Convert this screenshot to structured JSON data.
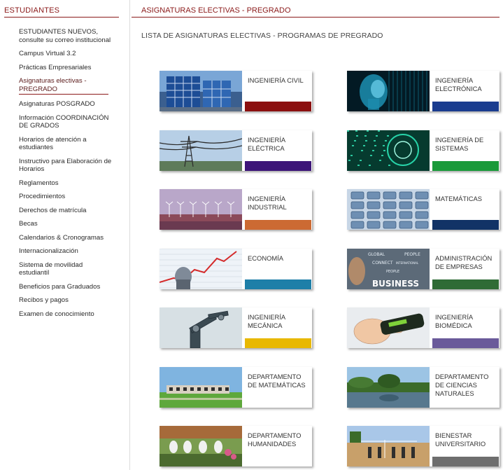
{
  "sidebar": {
    "title": "ESTUDIANTES",
    "items": [
      {
        "label": "ESTUDIANTES NUEVOS, consulte su correo institucional"
      },
      {
        "label": "Campus Virtual 3.2"
      },
      {
        "label": "Prácticas Empresariales"
      },
      {
        "label": "Asignaturas electivas - PREGRADO",
        "active": true
      },
      {
        "label": "Asignaturas POSGRADO"
      },
      {
        "label": "Información COORDINACIÓN DE GRADOS"
      },
      {
        "label": "Horarios de atención a estudiantes"
      },
      {
        "label": "Instructivo para Elaboración de Horarios"
      },
      {
        "label": "Reglamentos"
      },
      {
        "label": "Procedimientos"
      },
      {
        "label": "Derechos de matrícula"
      },
      {
        "label": "Becas"
      },
      {
        "label": "Calendarios & Cronogramas"
      },
      {
        "label": "Internacionalización"
      },
      {
        "label": "Sistema de movilidad estudiantil"
      },
      {
        "label": "Beneficios para Graduados"
      },
      {
        "label": "Recibos y pagos"
      },
      {
        "label": "Examen de conocimiento"
      }
    ]
  },
  "main": {
    "title": "ASIGNATURAS ELECTIVAS - PREGRADO",
    "subtitle": "LISTA DE ASIGNATURAS ELECTIVAS - PROGRAMAS DE PREGRADO",
    "image_text": {
      "business_main": "BUSINESS",
      "business_words": [
        "GLOBAL",
        "PEOPLE",
        "CONNECT",
        "INTERNATIONAL",
        "PEOPLE"
      ]
    },
    "cards": [
      {
        "label": "INGENIERÍA CIVIL",
        "color": "#8b0f0f",
        "image": "civil-building"
      },
      {
        "label": "INGENIERÍA ELECTRÓNICA",
        "color": "#1a3c8f",
        "image": "digital-face"
      },
      {
        "label": "INGENIERÍA ELÉCTRICA",
        "color": "#3d1578",
        "image": "power-tower"
      },
      {
        "label": "INGENIERÍA DE SISTEMAS",
        "color": "#1a9a3a",
        "image": "digital-circuit"
      },
      {
        "label": "INGENIERÍA INDUSTRIAL",
        "color": "#cc6a33",
        "image": "wind-farm"
      },
      {
        "label": "MATEMÁTICAS",
        "color": "#123366",
        "image": "calculator-keys"
      },
      {
        "label": "ECONOMÍA",
        "color": "#1e7fa8",
        "image": "growth-chart"
      },
      {
        "label": "ADMINISTRACIÓN DE EMPRESAS",
        "color": "#2f6b35",
        "image": "business-words"
      },
      {
        "label": "INGENIERÍA MECÁNICA",
        "color": "#e8b800",
        "image": "robot-arm"
      },
      {
        "label": "INGENIERÍA BIOMÉDICA",
        "color": "#6a5a9a",
        "image": "hand-device"
      },
      {
        "label": "DEPARTAMENTO DE MATEMÁTICAS",
        "color": "#ffffff",
        "image": "campus-building"
      },
      {
        "label": "DEPARTAMENTO DE CIENCIAS NATURALES",
        "color": "#ffffff",
        "image": "lake-forest"
      },
      {
        "label": "DEPARTAMENTO HUMANIDADES",
        "color": "#ffffff",
        "image": "students-garden"
      },
      {
        "label": "BIENESTAR UNIVERSITARIO",
        "color": "#6e6e6e",
        "image": "sports-field"
      }
    ]
  }
}
